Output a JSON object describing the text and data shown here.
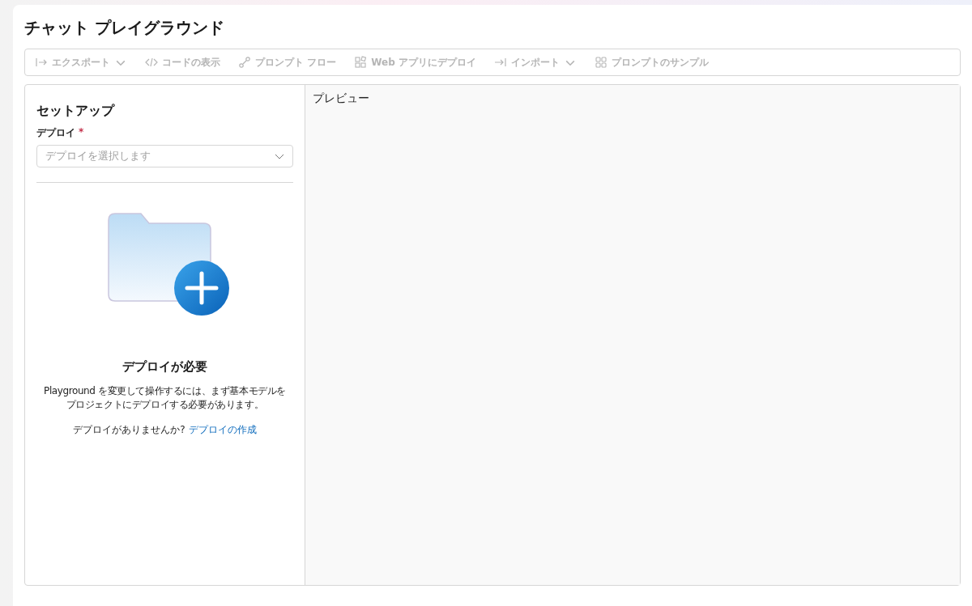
{
  "page": {
    "title": "チャット プレイグラウンド"
  },
  "toolbar": [
    {
      "kind": "export",
      "label": "エクスポート",
      "dropdown": true,
      "disabled": true
    },
    {
      "kind": "code",
      "label": "コードの表示",
      "dropdown": false,
      "disabled": true
    },
    {
      "kind": "flow",
      "label": "プロンプト フロー",
      "dropdown": false,
      "disabled": true
    },
    {
      "kind": "webapp",
      "label": "Web アプリにデプロイ",
      "dropdown": false,
      "disabled": true
    },
    {
      "kind": "import",
      "label": "インポート",
      "dropdown": true,
      "disabled": true
    },
    {
      "kind": "samples",
      "label": "プロンプトのサンプル",
      "dropdown": false,
      "disabled": true
    }
  ],
  "setup": {
    "title": "セットアップ",
    "field_label": "デプロイ",
    "required_mark": "*",
    "placeholder": "デプロイを選択します",
    "empty_state": {
      "heading": "デプロイが必要",
      "message_lines": [
        "Playground を変更して操作するには、まず基本モデルを",
        "プロジェクトにデプロイする必要があります。"
      ],
      "prompt": "デプロイがありませんか?",
      "link": "デプロイの作成"
    }
  },
  "preview": {
    "title": "プレビュー"
  }
}
